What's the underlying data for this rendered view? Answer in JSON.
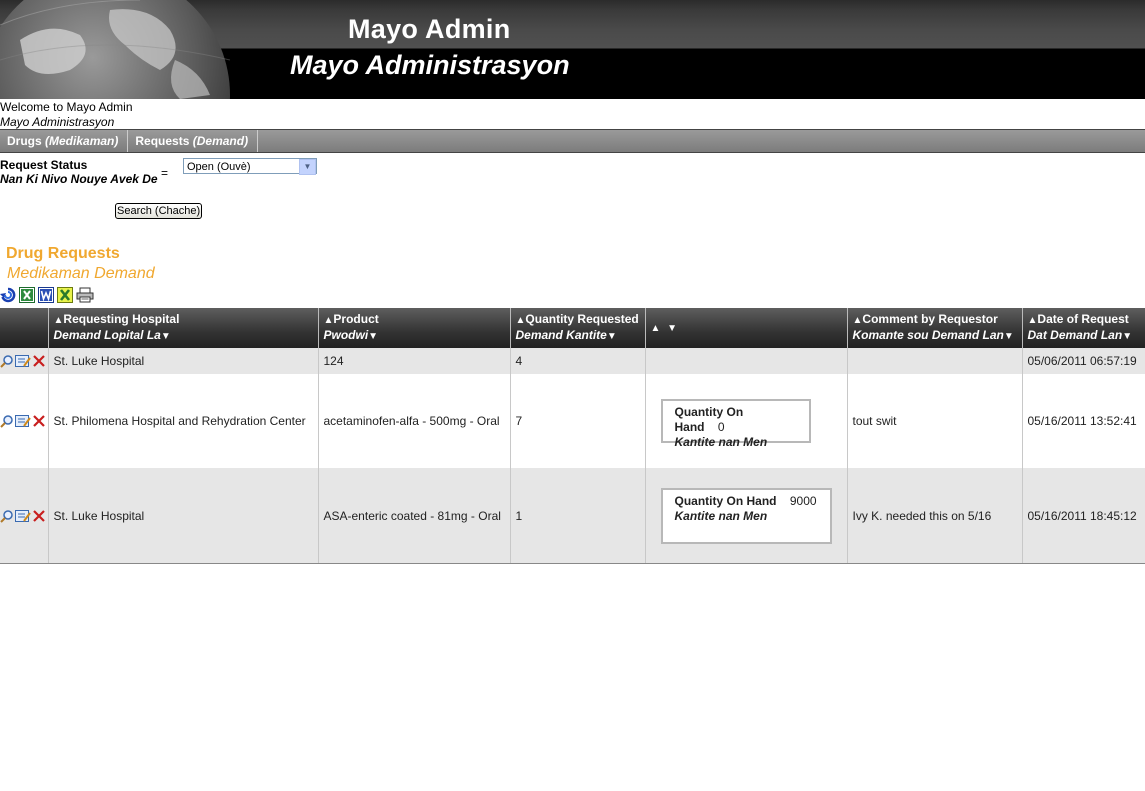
{
  "header": {
    "title": "Mayo Admin",
    "subtitle": "Mayo Administrasyon"
  },
  "welcome": {
    "line1": "Welcome to Mayo Admin",
    "line2": "Mayo Administrasyon"
  },
  "nav": {
    "drugs": "Drugs",
    "drugs_alt": "(Medikaman)",
    "requests": "Requests",
    "requests_alt": "(Demand)"
  },
  "filter": {
    "label": "Request Status",
    "label_alt": "Nan Ki Nivo Nouye Avek De",
    "operator": "=",
    "status_value": "Open (Ouvè)",
    "search_label": "Search (Chache)"
  },
  "section": {
    "title": "Drug Requests",
    "subtitle": "Medikaman Demand"
  },
  "columns": {
    "hospital": "Requesting Hospital",
    "hospital_alt": "Demand Lopital La",
    "product": "Product",
    "product_alt": "Pwodwi",
    "quantity": "Quantity Requested",
    "quantity_alt": "Demand Kantite",
    "comment": "Comment by Requestor",
    "comment_alt": "Komante sou Demand Lan",
    "date": "Date of Request",
    "date_alt": "Dat Demand Lan"
  },
  "qoh": {
    "label": "Quantity On Hand",
    "label_alt": "Kantite nan Men"
  },
  "rows": [
    {
      "hospital": "St. Luke Hospital",
      "product": "124",
      "quantity": "4",
      "qoh": "",
      "comment": "",
      "date": "05/06/2011 06:57:19"
    },
    {
      "hospital": "St. Philomena Hospital and Rehydration Center",
      "product": "acetaminofen-alfa - 500mg - Oral",
      "quantity": "7",
      "qoh": "0",
      "comment": "tout swit",
      "date": "05/16/2011 13:52:41"
    },
    {
      "hospital": "St. Luke Hospital",
      "product": "ASA-enteric coated - 81mg - Oral",
      "quantity": "1",
      "qoh": "9000",
      "comment": "Ivy K. needed this on 5/16",
      "date": "05/16/2011 18:45:12"
    }
  ],
  "colors": {
    "accent": "#f0a830",
    "header_bg": "#000000",
    "row_alt": "#e6e6e6"
  }
}
